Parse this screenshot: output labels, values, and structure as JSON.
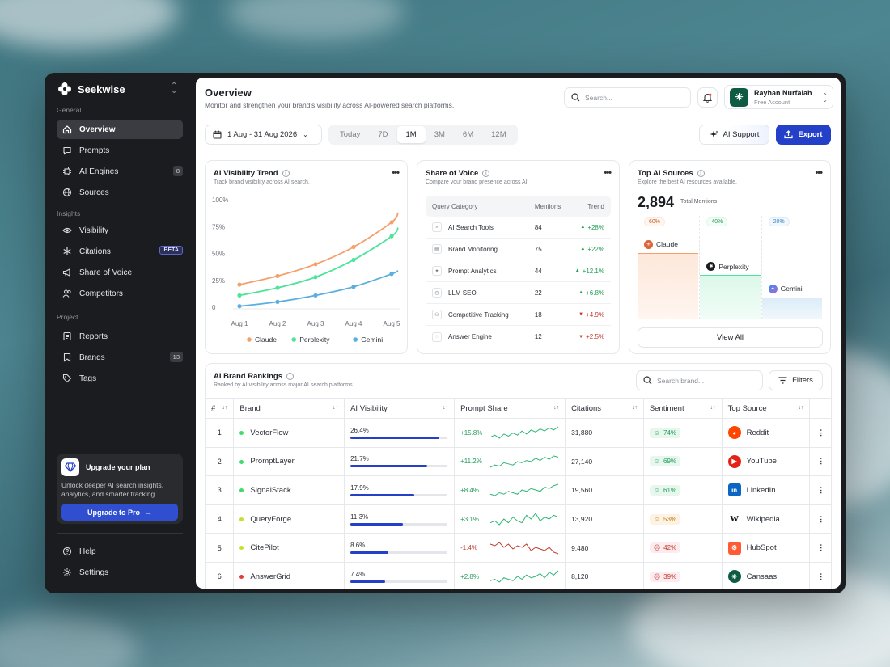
{
  "app": {
    "name": "Seekwise"
  },
  "sidebar": {
    "sections": {
      "general": "General",
      "insights": "Insights",
      "project": "Project"
    },
    "items": [
      {
        "label": "Overview",
        "icon": "home-icon"
      },
      {
        "label": "Prompts",
        "icon": "chat-icon"
      },
      {
        "label": "AI Engines",
        "icon": "chip-icon",
        "count": "8"
      },
      {
        "label": "Sources",
        "icon": "globe-icon"
      },
      {
        "label": "Visibility",
        "icon": "eye-icon"
      },
      {
        "label": "Citations",
        "icon": "asterisk-icon",
        "badge": "BETA"
      },
      {
        "label": "Share of Voice",
        "icon": "megaphone-icon"
      },
      {
        "label": "Competitors",
        "icon": "users-icon"
      },
      {
        "label": "Reports",
        "icon": "report-icon"
      },
      {
        "label": "Brands",
        "icon": "bookmark-icon",
        "count": "13"
      },
      {
        "label": "Tags",
        "icon": "tag-icon"
      },
      {
        "label": "Help",
        "icon": "help-icon"
      },
      {
        "label": "Settings",
        "icon": "settings-icon"
      }
    ],
    "upgrade": {
      "title": "Upgrade your plan",
      "description": "Unlock deeper AI search insights, analytics, and smarter tracking.",
      "button": "Upgrade to Pro"
    }
  },
  "header": {
    "title": "Overview",
    "subtitle": "Monitor and strengthen your brand's visibility across AI-powered search platforms.",
    "search_placeholder": "Search...",
    "user": {
      "name": "Rayhan Nurfalah",
      "role": "Free Account"
    }
  },
  "toolbar": {
    "date_range": "1 Aug - 31 Aug 2026",
    "ranges": [
      "Today",
      "7D",
      "1M",
      "3M",
      "6M",
      "12M"
    ],
    "active_range": "1M",
    "ai_support": "AI Support",
    "export": "Export"
  },
  "trend_card": {
    "title": "AI Visibility Trend",
    "subtitle": "Track brand visibility across AI search.",
    "chart_data": {
      "type": "line",
      "x": [
        "Aug 1",
        "Aug 2",
        "Aug 3",
        "Aug 4",
        "Aug 5"
      ],
      "ylim": [
        0,
        100
      ],
      "yticks": [
        "100%",
        "75%",
        "50%",
        "25%",
        "0"
      ],
      "series": [
        {
          "name": "Claude",
          "color": "#f4a06b",
          "values": [
            21,
            29,
            40,
            56,
            79
          ]
        },
        {
          "name": "Perplexity",
          "color": "#4fe39b",
          "values": [
            11,
            18,
            28,
            44,
            66
          ]
        },
        {
          "name": "Gemini",
          "color": "#5aaee0",
          "values": [
            1,
            5,
            11,
            19,
            31
          ]
        }
      ],
      "series_end": [
        {
          "name": "Claude",
          "value": 88
        },
        {
          "name": "Perplexity",
          "value": 74
        },
        {
          "name": "Gemini",
          "value": 34
        }
      ]
    }
  },
  "sov_card": {
    "title": "Share of Voice",
    "subtitle": "Compare your brand presence across AI.",
    "columns": [
      "Query Category",
      "Mentions",
      "Trend"
    ],
    "rows": [
      {
        "category": "AI Search Tools",
        "mentions": "84",
        "trend": "+28%",
        "dir": "up"
      },
      {
        "category": "Brand Monitoring",
        "mentions": "75",
        "trend": "+22%",
        "dir": "up"
      },
      {
        "category": "Prompt Analytics",
        "mentions": "44",
        "trend": "+12.1%",
        "dir": "up"
      },
      {
        "category": "LLM SEO",
        "mentions": "22",
        "trend": "+6.8%",
        "dir": "up"
      },
      {
        "category": "Competitive Tracking",
        "mentions": "18",
        "trend": "+4.9%",
        "dir": "down"
      },
      {
        "category": "Answer Engine",
        "mentions": "12",
        "trend": "+2.5%",
        "dir": "down"
      }
    ]
  },
  "sources_card": {
    "title": "Top AI Sources",
    "subtitle": "Explore the best AI resources available.",
    "total": "2,894",
    "total_label": "Total Mentions",
    "sources": [
      {
        "name": "Claude",
        "percent": "60%",
        "value": 60,
        "color": "#f4a06b"
      },
      {
        "name": "Perplexity",
        "percent": "40%",
        "value": 40,
        "color": "#4fe39b"
      },
      {
        "name": "Gemini",
        "percent": "20%",
        "value": 20,
        "color": "#5aaee0"
      }
    ],
    "view_all": "View All"
  },
  "rankings": {
    "title": "AI Brand Rankings",
    "subtitle": "Ranked by AI visibility across major AI search platforms",
    "search_placeholder": "Search brand...",
    "filters": "Filters",
    "columns": [
      "#",
      "Brand",
      "AI Visibility",
      "Prompt Share",
      "Citations",
      "Sentiment",
      "Top Source"
    ],
    "rows": [
      {
        "rank": "1",
        "brand": "VectorFlow",
        "dot": "#3ddc6b",
        "visibility": "26.4%",
        "vis_value": 0.92,
        "share": "+15.8%",
        "share_dir": "up",
        "spark": [
          6,
          8,
          5,
          9,
          7,
          10,
          8,
          12,
          9,
          13,
          11,
          14,
          12,
          15,
          13,
          16
        ],
        "citations": "31,880",
        "sentiment": "74%",
        "senti": "good",
        "source": "Reddit",
        "source_color": "#ff4500"
      },
      {
        "rank": "2",
        "brand": "PromptLayer",
        "dot": "#3ddc6b",
        "visibility": "21.7%",
        "vis_value": 0.79,
        "share": "+11.2%",
        "share_dir": "up",
        "spark": [
          5,
          7,
          6,
          9,
          8,
          7,
          10,
          9,
          11,
          10,
          13,
          11,
          14,
          12,
          15,
          14
        ],
        "citations": "27,140",
        "sentiment": "69%",
        "senti": "good",
        "source": "YouTube",
        "source_color": "#e62117"
      },
      {
        "rank": "3",
        "brand": "SignalStack",
        "dot": "#3ddc6b",
        "visibility": "17.9%",
        "vis_value": 0.66,
        "share": "+8.4%",
        "share_dir": "up",
        "spark": [
          7,
          6,
          8,
          7,
          9,
          8,
          7,
          10,
          9,
          11,
          10,
          9,
          12,
          11,
          13,
          14
        ],
        "citations": "19,560",
        "sentiment": "61%",
        "senti": "good",
        "source": "LinkedIn",
        "source_color": "#0a66c2"
      },
      {
        "rank": "4",
        "brand": "QueryForge",
        "dot": "#c7df2a",
        "visibility": "11.3%",
        "vis_value": 0.54,
        "share": "+3.1%",
        "share_dir": "up",
        "spark": [
          8,
          9,
          7,
          10,
          8,
          11,
          9,
          8,
          12,
          10,
          13,
          9,
          11,
          10,
          12,
          11
        ],
        "citations": "13,920",
        "sentiment": "53%",
        "senti": "mid",
        "source": "Wikipedia",
        "source_color": "#ffffff"
      },
      {
        "rank": "5",
        "brand": "CitePilot",
        "dot": "#c7df2a",
        "visibility": "8.6%",
        "vis_value": 0.39,
        "share": "-1.4%",
        "share_dir": "down",
        "spark": [
          12,
          11,
          13,
          10,
          12,
          9,
          11,
          10,
          12,
          8,
          10,
          9,
          8,
          10,
          7,
          6
        ],
        "citations": "9,480",
        "sentiment": "42%",
        "senti": "bad",
        "source": "HubSpot",
        "source_color": "#ff5c35"
      },
      {
        "rank": "6",
        "brand": "AnswerGrid",
        "dot": "#e23b3b",
        "visibility": "7.4%",
        "vis_value": 0.36,
        "share": "+2.8%",
        "share_dir": "up",
        "spark": [
          6,
          7,
          5,
          8,
          7,
          6,
          9,
          7,
          10,
          8,
          9,
          11,
          8,
          12,
          10,
          13
        ],
        "citations": "8,120",
        "sentiment": "39%",
        "senti": "bad",
        "source": "Cansaas",
        "source_color": "#0e5a43"
      }
    ]
  }
}
